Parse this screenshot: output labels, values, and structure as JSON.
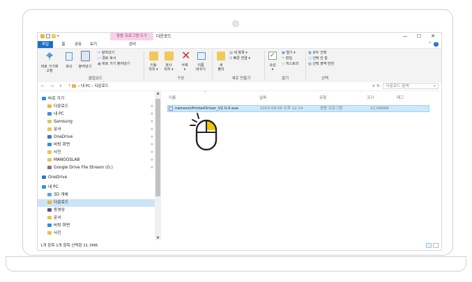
{
  "window": {
    "ribbon_context_tab": "응용 프로그램 도구",
    "title": "다운로드",
    "controls": [
      "—",
      "☐",
      "✕"
    ]
  },
  "ribbon_tabs": [
    {
      "label": "파일"
    },
    {
      "label": "홈"
    },
    {
      "label": "공유"
    },
    {
      "label": "보기"
    },
    {
      "label": "관리"
    }
  ],
  "ribbon": {
    "clipboard": {
      "pin_quick": "바로 가기에\n고정",
      "copy": "복사",
      "paste": "붙여넣기",
      "cut": "잘라내기",
      "copy_path": "경로 복사",
      "paste_shortcut": "바로 가기 붙여넣기",
      "group": "클립보드"
    },
    "organize": {
      "move_to": "이동\n위치 ▾",
      "copy_to": "복사\n위치 ▾",
      "delete": "삭제\n▾",
      "rename": "이름\n바꾸기",
      "group": "구성"
    },
    "new": {
      "new_folder": "새\n폴더",
      "new_item": "새 항목 ▾",
      "easy_access": "빠른 연결 ▾",
      "group": "새로 만들기"
    },
    "open": {
      "properties": "속성\n▾",
      "open": "열기 ▾",
      "edit": "편집",
      "history": "히스토리",
      "group": "열기"
    },
    "select": {
      "select_all": "모두 선택",
      "select_none": "선택 안 함",
      "invert": "선택 영역 반전",
      "group": "선택"
    }
  },
  "address": {
    "nav_buttons": "← → ∨ ↑",
    "breadcrumb": "› 내 PC › 다운로드",
    "search_placeholder": "다운로드 검색",
    "refresh": "∨ ↻"
  },
  "nav_pane": {
    "items": [
      {
        "label": "바로 가기",
        "color": "#2e8be6",
        "indent": 0,
        "pinned": false
      },
      {
        "label": "다운로드",
        "color": "#e9b640",
        "indent": 1,
        "pinned": true
      },
      {
        "label": "내 PC",
        "color": "#3c8fd8",
        "indent": 1,
        "pinned": true
      },
      {
        "label": "Samsung",
        "color": "#e9c250",
        "indent": 1,
        "pinned": true
      },
      {
        "label": "문서",
        "color": "#e9c250",
        "indent": 1,
        "pinned": true
      },
      {
        "label": "OneDrive",
        "color": "#2b79d1",
        "indent": 1,
        "pinned": true
      },
      {
        "label": "바탕 화면",
        "color": "#2f8fe0",
        "indent": 1,
        "pinned": true
      },
      {
        "label": "사진",
        "color": "#e9c250",
        "indent": 1,
        "pinned": true
      },
      {
        "label": "MANGOSLAB",
        "color": "#e9c250",
        "indent": 1,
        "pinned": true
      },
      {
        "label": "Google Drive File Stream (G:)",
        "color": "#7a7a7a",
        "indent": 1,
        "pinned": true
      },
      {
        "label": "OneDrive",
        "color": "#2b79d1",
        "indent": 0,
        "pinned": false
      },
      {
        "label": "내 PC",
        "color": "#3c8fd8",
        "indent": 0,
        "pinned": false
      },
      {
        "label": "3D 개체",
        "color": "#5aa7e8",
        "indent": 1,
        "pinned": false
      },
      {
        "label": "다운로드",
        "color": "#e9b640",
        "indent": 1,
        "pinned": false,
        "selected": true
      },
      {
        "label": "동영상",
        "color": "#555577",
        "indent": 1,
        "pinned": false
      },
      {
        "label": "문서",
        "color": "#e9c250",
        "indent": 1,
        "pinned": false
      },
      {
        "label": "바탕 화면",
        "color": "#2f8fe0",
        "indent": 1,
        "pinned": false
      },
      {
        "label": "사진",
        "color": "#e9c250",
        "indent": 1,
        "pinned": false
      }
    ],
    "pin_glyph": "✲"
  },
  "list": {
    "headers": {
      "name": "이름",
      "date": "날짜",
      "type": "유형",
      "size": "크기",
      "tags": "태그"
    },
    "rows": [
      {
        "name": "nemonicPrinterDriver_V2.0.0.exe",
        "date": "2019-08-08 오후 12:14",
        "type": "응용 프로그램",
        "size": "32,068KB"
      }
    ]
  },
  "status": {
    "text": "1개 항목    1개 항목 선택함 31.3MB"
  },
  "colors": {
    "accent": "#1a6fc9",
    "selection": "#cce8ff",
    "mouse_highlight": "#f5c400"
  }
}
